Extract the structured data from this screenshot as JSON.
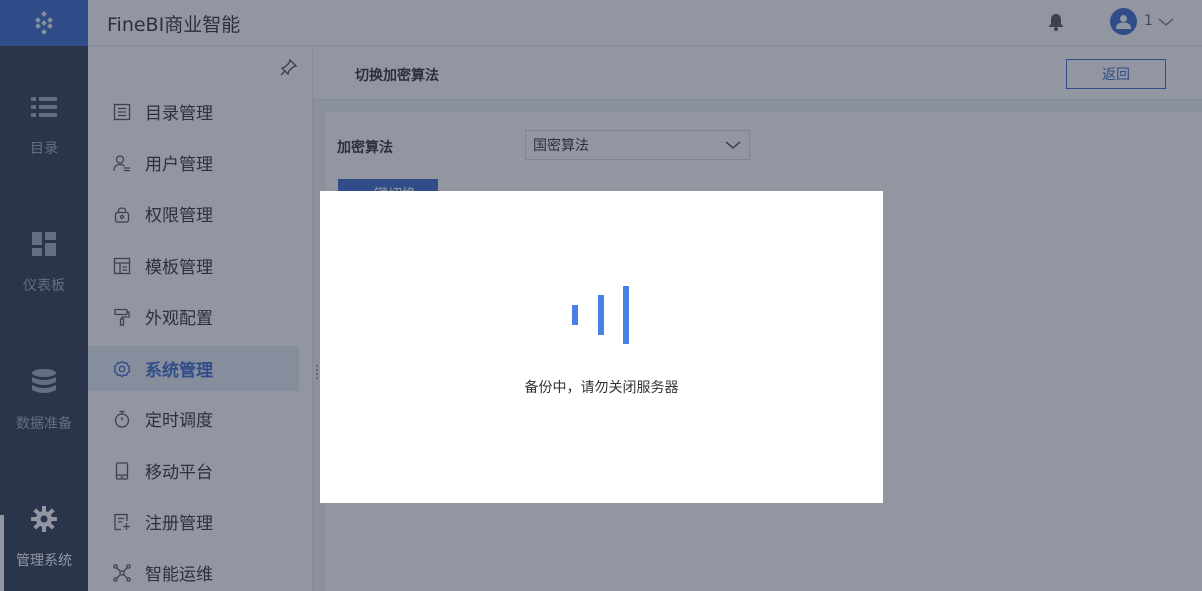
{
  "header": {
    "app_title": "FineBI商业智能",
    "user_name": "1"
  },
  "rail": {
    "items": [
      {
        "label": "目录",
        "icon": "list-icon"
      },
      {
        "label": "仪表板",
        "icon": "dashboard-icon"
      },
      {
        "label": "数据准备",
        "icon": "database-icon"
      },
      {
        "label": "管理系统",
        "icon": "gear-icon",
        "active": true
      }
    ]
  },
  "subnav": {
    "items": [
      {
        "label": "目录管理",
        "icon": "catalog-icon"
      },
      {
        "label": "用户管理",
        "icon": "user-icon"
      },
      {
        "label": "权限管理",
        "icon": "lock-icon"
      },
      {
        "label": "模板管理",
        "icon": "template-icon"
      },
      {
        "label": "外观配置",
        "icon": "paint-roller-icon"
      },
      {
        "label": "系统管理",
        "icon": "gear-icon",
        "active": true
      },
      {
        "label": "定时调度",
        "icon": "timer-icon"
      },
      {
        "label": "移动平台",
        "icon": "mobile-icon"
      },
      {
        "label": "注册管理",
        "icon": "register-icon"
      },
      {
        "label": "智能运维",
        "icon": "network-icon"
      }
    ]
  },
  "main": {
    "title": "切换加密算法",
    "back_label": "返回",
    "encryption_label": "加密算法",
    "encryption_value": "国密算法",
    "switch_label": "一键切换"
  },
  "modal": {
    "message": "备份中，请勿关闭服务器"
  },
  "colors": {
    "accent": "#3e6cd0",
    "rail_bg": "#313c54",
    "loader": "#4a7fe6"
  }
}
